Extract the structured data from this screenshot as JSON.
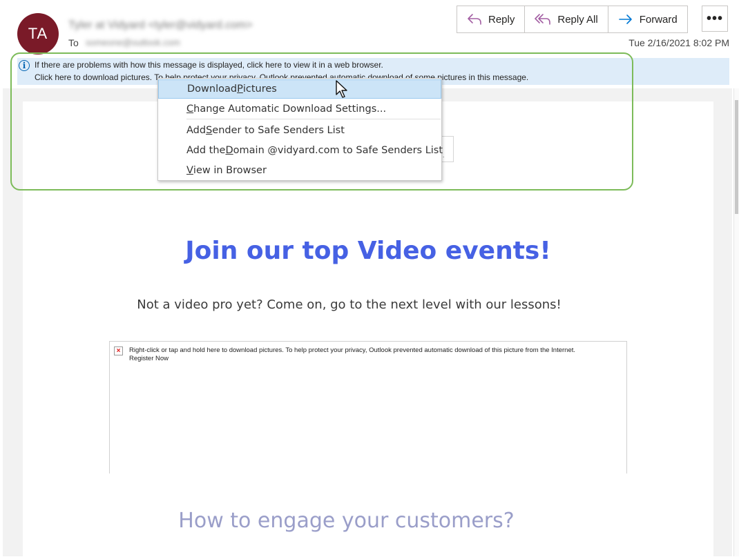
{
  "header": {
    "avatar_initials": "TA",
    "sender": "Tyler at Vidyard <tyler@vidyard.com>",
    "to_label": "To",
    "to_value": "someone@outlook.com",
    "date": "Tue 2/16/2021 8:02 PM"
  },
  "actions": {
    "reply": "Reply",
    "reply_all": "Reply All",
    "forward": "Forward",
    "more": "•••"
  },
  "infobar": {
    "line1": "If there are problems with how this message is displayed, click here to view it in a web browser.",
    "line2": "Click here to download pictures. To help protect your privacy, Outlook prevented automatic download of some pictures in this message."
  },
  "context_menu": {
    "items": [
      {
        "pre": "Download ",
        "key": "P",
        "post": "ictures"
      },
      {
        "pre": "",
        "key": "C",
        "post": "hange Automatic Download Settings..."
      },
      {
        "pre": "Add ",
        "key": "S",
        "post": "ender to Safe Senders List"
      },
      {
        "pre": "Add the ",
        "key": "D",
        "post": "omain @vidyard.com to Safe Senders List"
      },
      {
        "pre": "",
        "key": "V",
        "post": "iew in Browser"
      }
    ]
  },
  "email": {
    "headline": "Join our top Video events!",
    "subline": "Not a video pro yet? Come on, go to the next level with our lessons!",
    "image_placeholder": "Right-click or tap and hold here to download pictures. To help protect your privacy, Outlook prevented automatic download of this picture from the Internet.",
    "image_alt": "Register Now",
    "section_heading": "How to engage your customers?"
  },
  "colors": {
    "avatar": "#7a1a28",
    "reply_icon": "#a35fa3",
    "forward_icon": "#0078d4",
    "headline": "#4661e4",
    "highlight_border": "#7cbb59",
    "infobar_bg": "#deecf9"
  }
}
